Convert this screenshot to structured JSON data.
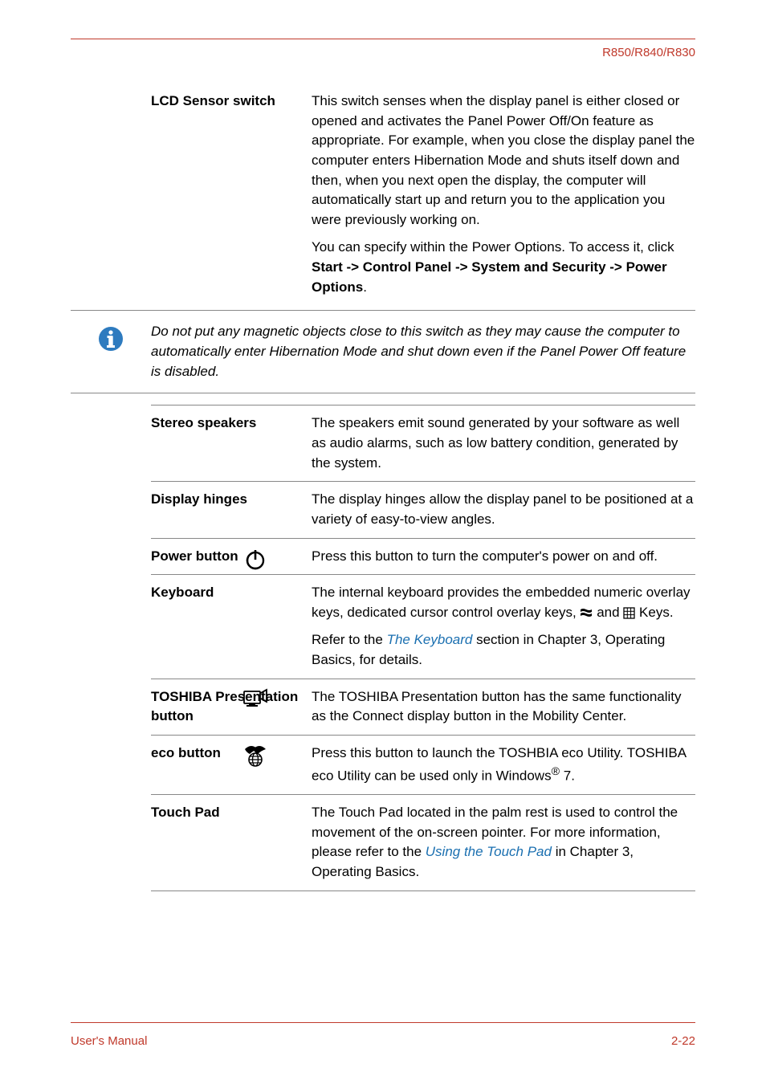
{
  "header": {
    "model": "R850/R840/R830"
  },
  "rows": {
    "lcd_sensor": {
      "label": "LCD Sensor switch",
      "p1": "This switch senses when the display panel is either closed or opened and activates the Panel Power Off/On feature as appropriate. For example, when you close the display panel the computer enters Hibernation Mode and shuts itself down and then, when you next open the display, the computer will automatically start up and return you to the application you were previously working on.",
      "p2a": "You can specify within the Power Options. To access it, click ",
      "p2b": "Start -> Control Panel -> System and Security -> Power Options",
      "p2c": "."
    },
    "callout": {
      "text": "Do not put any magnetic objects close to this switch as they may cause the computer to automatically enter Hibernation Mode and shut down even if the Panel Power Off feature is disabled."
    },
    "stereo": {
      "label": "Stereo speakers",
      "desc": "The speakers emit sound generated by your software as well as audio alarms, such as low battery condition, generated by the system."
    },
    "hinges": {
      "label": "Display hinges",
      "desc": "The display hinges allow the display panel to be positioned at a variety of easy-to-view angles."
    },
    "power": {
      "label": "Power button",
      "desc": "Press this button to turn the computer's power on and off."
    },
    "keyboard": {
      "label": "Keyboard",
      "p1a": "The internal keyboard provides the embedded numeric overlay keys, dedicated cursor control overlay keys, ",
      "p1b": " and ",
      "p1c": " Keys.",
      "p2a": "Refer to the ",
      "p2link": "The Keyboard",
      "p2b": " section in Chapter 3, Operating Basics, for details."
    },
    "presenta": {
      "label": "TOSHIBA Presenta­tion button",
      "desc": "The TOSHIBA Presentation button has the same functionality as the Connect display button in the Mobility Center."
    },
    "eco": {
      "label": "eco button",
      "p_a": "Press this button to launch the TOSHBIA eco Utility. TOSHIBA eco Utility can be used only in Windows",
      "p_sup": "®",
      "p_b": " 7."
    },
    "touch": {
      "label": "Touch Pad",
      "p_a": "The Touch Pad located in the palm rest is used to control the movement of the on-screen pointer. For more information, please refer to the ",
      "link1": "Using the Touch Pad",
      "p_b": " in Chapter 3, Operating Basics."
    }
  },
  "footer": {
    "left": "User's Manual",
    "right": "2-22"
  },
  "icons": {
    "info": "info-icon",
    "power": "power-icon",
    "present": "presentation-icon",
    "eco": "leaf-globe-icon",
    "win": "windows-flag-icon",
    "numlock": "numlock-icon"
  }
}
